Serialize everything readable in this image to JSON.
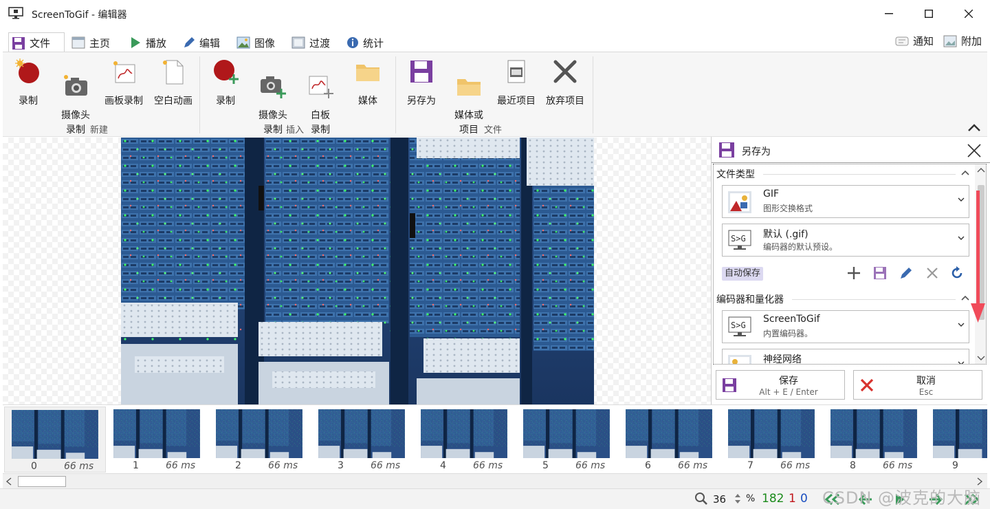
{
  "window": {
    "title": "ScreenToGif - 编辑器"
  },
  "tabs": [
    {
      "label": "文件",
      "icon": "save-icon"
    },
    {
      "label": "主页",
      "icon": "home-icon"
    },
    {
      "label": "播放",
      "icon": "play-icon"
    },
    {
      "label": "编辑",
      "icon": "pencil-icon"
    },
    {
      "label": "图像",
      "icon": "image-icon"
    },
    {
      "label": "过渡",
      "icon": "transition-icon"
    },
    {
      "label": "统计",
      "icon": "info-icon"
    }
  ],
  "right_tabs": [
    {
      "label": "通知",
      "icon": "notification-icon"
    },
    {
      "label": "附加",
      "icon": "extras-icon"
    }
  ],
  "ribbon": {
    "groups": [
      {
        "label": "新建",
        "buttons": [
          "录制",
          "摄像头\n录制",
          "画板录制",
          "空白动画"
        ]
      },
      {
        "label": "插入",
        "buttons": [
          "录制",
          "摄像头\n录制",
          "白板\n录制",
          "媒体"
        ]
      },
      {
        "label": "文件",
        "buttons": [
          "另存为",
          "媒体或\n项目",
          "最近项目",
          "放弃项目"
        ]
      }
    ]
  },
  "save_panel": {
    "title": "另存为",
    "file_type_section": "文件类型",
    "file_type": {
      "main": "GIF",
      "sub": "图形交换格式"
    },
    "preset": {
      "main": "默认 (.gif)",
      "sub": "编码器的默认预设。"
    },
    "autosave_label": "自动保存",
    "encoder_section": "编码器和量化器",
    "encoder": {
      "main": "ScreenToGif",
      "sub": "内置编码器。"
    },
    "encoder2": {
      "main": "神经网络"
    },
    "save_button": {
      "label": "保存",
      "shortcut": "Alt + E / Enter"
    },
    "cancel_button": {
      "label": "取消",
      "shortcut": "Esc"
    }
  },
  "frames": [
    {
      "index": "0",
      "delay": "66 ms"
    },
    {
      "index": "1",
      "delay": "66 ms"
    },
    {
      "index": "2",
      "delay": "66 ms"
    },
    {
      "index": "3",
      "delay": "66 ms"
    },
    {
      "index": "4",
      "delay": "66 ms"
    },
    {
      "index": "5",
      "delay": "66 ms"
    },
    {
      "index": "6",
      "delay": "66 ms"
    },
    {
      "index": "7",
      "delay": "66 ms"
    },
    {
      "index": "8",
      "delay": "66 ms"
    },
    {
      "index": "9",
      "delay": ""
    }
  ],
  "status": {
    "zoom": "36",
    "zoom_unit": "%",
    "frame_count": "182",
    "selected_count": "1",
    "current_index": "0"
  },
  "watermark": "CSDN @波克的大脑",
  "colors": {
    "accent": "#7a3fa0",
    "record_red": "#b0181a",
    "total_green": "#1a8a1a",
    "selected_red": "#c0141a",
    "index_blue": "#1a4ec0"
  }
}
